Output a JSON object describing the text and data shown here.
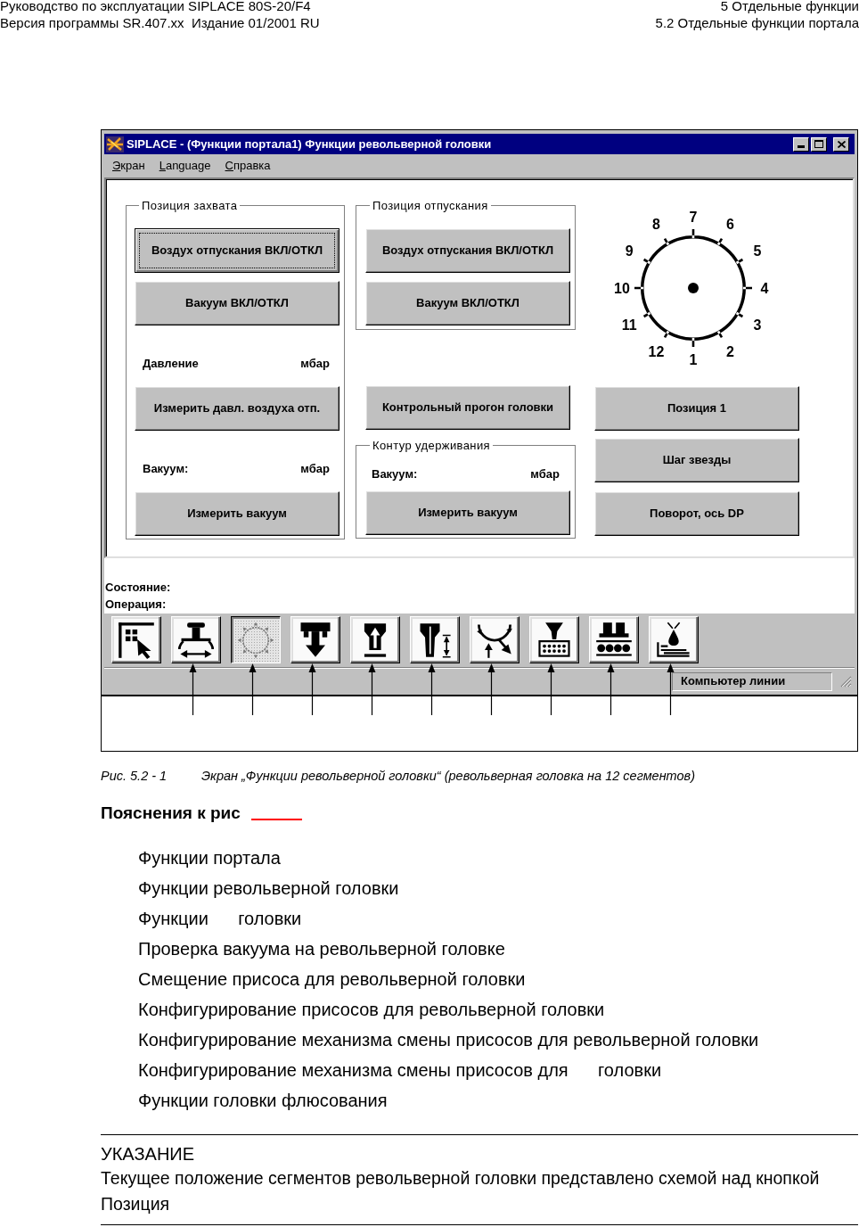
{
  "header": {
    "left": [
      "Руководство по эксплуатации SIPLACE 80S-20/F4",
      "Версия программы SR.407.xx  Издание 01/2001 RU"
    ],
    "right": [
      "5 Отдельные функции",
      "5.2 Отдельные функции портала"
    ]
  },
  "window": {
    "title": "SIPLACE - (Функции портала1) Функции револьверной головки",
    "menu": [
      "Экран",
      "Language",
      "Справка"
    ],
    "pickup": {
      "title": "Позиция захвата",
      "toggles": [
        {
          "label": "Воздух отпускания ВКЛ/ОТКЛ",
          "focused": true
        },
        {
          "label": "Вакуум ВКЛ/ОТКЛ",
          "focused": false
        }
      ],
      "pressure": {
        "label": "Давление",
        "unit": "мбар"
      },
      "pressure_button": {
        "label": "Измерить давл. воздуха отп.",
        "focused": false
      },
      "vacuum": {
        "label": "Вакуум:",
        "unit": "мбар"
      },
      "vacuum_button": {
        "label": "Измерить вакуум",
        "focused": false
      }
    },
    "release": {
      "title": "Позиция отпускания",
      "toggles": [
        {
          "label": "Воздух отпускания ВКЛ/ОТКЛ",
          "focused": false
        },
        {
          "label": "Вакуум ВКЛ/ОТКЛ",
          "focused": false
        }
      ]
    },
    "test_run_button": {
      "label": "Контрольный прогон головки",
      "focused": false
    },
    "hold_circuit": {
      "title": "Контур удерживания",
      "vacuum": {
        "label": "Вакуум:",
        "unit": "мбар"
      },
      "vacuum_button": {
        "label": "Измерить вакуум",
        "focused": false
      }
    },
    "dial": {
      "segments": [
        "1",
        "2",
        "3",
        "4",
        "5",
        "6",
        "7",
        "8",
        "9",
        "10",
        "11",
        "12"
      ]
    },
    "head_buttons": [
      {
        "label": "Позиция 1",
        "focused": false
      },
      {
        "label": "Шаг звезды",
        "focused": false
      },
      {
        "label": "Поворот, ось DP",
        "focused": false
      }
    ],
    "status": {
      "state_label": "Состояние:",
      "operation_label": "Операция:"
    },
    "toolbar": [
      {
        "kind": "overview",
        "selected": false,
        "callout": false
      },
      {
        "kind": "shift",
        "selected": false,
        "callout": true
      },
      {
        "kind": "revolver",
        "selected": true,
        "callout": true
      },
      {
        "kind": "head",
        "selected": false,
        "callout": true
      },
      {
        "kind": "nozzle",
        "selected": false,
        "callout": true
      },
      {
        "kind": "height",
        "selected": false,
        "callout": true
      },
      {
        "kind": "star",
        "selected": false,
        "callout": true
      },
      {
        "kind": "tray",
        "selected": false,
        "callout": true
      },
      {
        "kind": "conveyor",
        "selected": false,
        "callout": true
      },
      {
        "kind": "flux",
        "selected": false,
        "callout": true
      }
    ],
    "status_bar": {
      "panel": "Компьютер линии"
    }
  },
  "figure": {
    "number": "Рис. 5.2 - 1",
    "caption": "Экран „Функции револьверной головки“ (револьверная головка на 12 сегментов)"
  },
  "legend": {
    "title": "Пояснения к рис",
    "items": [
      "Функции портала",
      "Функции револьверной головки",
      "Функции      головки",
      "Проверка вакуума на револьверной головке",
      "Смещение присоса для револьверной головки",
      "Конфигурирование присосов для револьверной головки",
      "Конфигурирование механизма смены присосов для револьверной головки",
      "Конфигурирование механизма смены присосов для      головки",
      "Функции головки флюсования"
    ]
  },
  "note": {
    "title": "УКАЗАНИЕ",
    "text": "Текущее положение сегментов револьверной головки представлено схемой над кнопкой Позиция"
  }
}
